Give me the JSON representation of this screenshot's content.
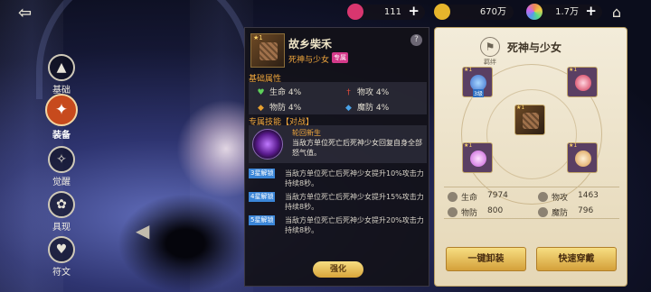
{
  "topbar": {
    "res1_value": "111",
    "res2_value": "670万",
    "res3_value": "1.7万",
    "plus": "+"
  },
  "menu": [
    {
      "label": "基础",
      "icon": "triangle-icon"
    },
    {
      "label": "装备",
      "icon": "equipment-icon"
    },
    {
      "label": "觉醒",
      "icon": "awaken-icon"
    },
    {
      "label": "具现",
      "icon": "manifest-icon"
    },
    {
      "label": "符文",
      "icon": "rune-icon"
    }
  ],
  "detail": {
    "item_name": "故乡柴禾",
    "owner": "死神与少女",
    "badge": "专属",
    "help": "?",
    "basic_title": "基础属性",
    "attrs": [
      {
        "name": "生命",
        "value": "4%"
      },
      {
        "name": "物攻",
        "value": "4%"
      },
      {
        "name": "物防",
        "value": "4%"
      },
      {
        "name": "魔防",
        "value": "4%"
      }
    ],
    "skill_title": "专属技能【对战】",
    "skill_name": "轮回新生",
    "skill_desc": "当敌方单位死亡后死神少女回复自身全部怒气值。",
    "unlocks": [
      {
        "tag": "3星解锁",
        "text": "当敌方单位死亡后死神少女提升10%攻击力持续8秒。"
      },
      {
        "tag": "4星解锁",
        "text": "当敌方单位死亡后死神少女提升15%攻击力持续8秒。"
      },
      {
        "tag": "5星解锁",
        "text": "当敌方单位死亡后死神少女提升20%攻击力持续8秒。"
      }
    ],
    "strengthen": "强化"
  },
  "right": {
    "emblem_label": "羁绊",
    "char_name": "死神与少女",
    "slot_label": "3级",
    "stats": [
      {
        "name": "生命",
        "value": "7974"
      },
      {
        "name": "物攻",
        "value": "1463"
      },
      {
        "name": "物防",
        "value": "800"
      },
      {
        "name": "魔防",
        "value": "796"
      }
    ],
    "unequip_all": "一键卸装",
    "quick_equip": "快速穿戴"
  },
  "colors": {
    "accent": "#f2a83d",
    "button": "#e6be5c",
    "tag_blue": "#3b86d8"
  }
}
